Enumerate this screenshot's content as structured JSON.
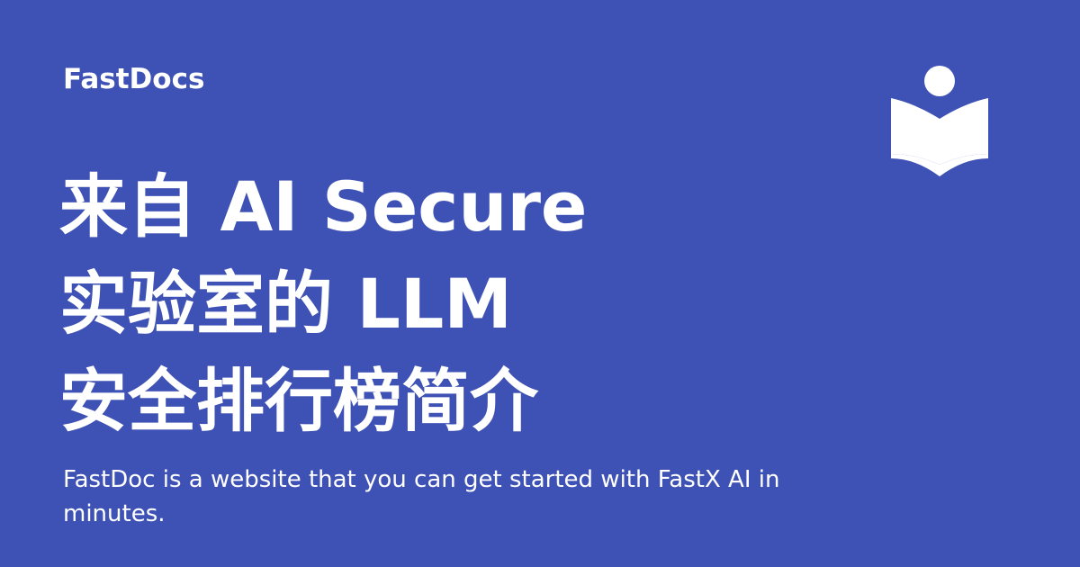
{
  "brand": {
    "name": "FastDocs"
  },
  "title": {
    "lines": [
      "来自 AI Secure",
      "实验室的 LLM",
      "安全排行榜简介"
    ]
  },
  "description": "FastDoc is a website that you can get started with FastX AI in minutes.",
  "logo": {
    "icon": "book-reader-icon",
    "color": "#ffffff"
  },
  "colors": {
    "background": "#3e51b5",
    "text": "#ffffff"
  }
}
